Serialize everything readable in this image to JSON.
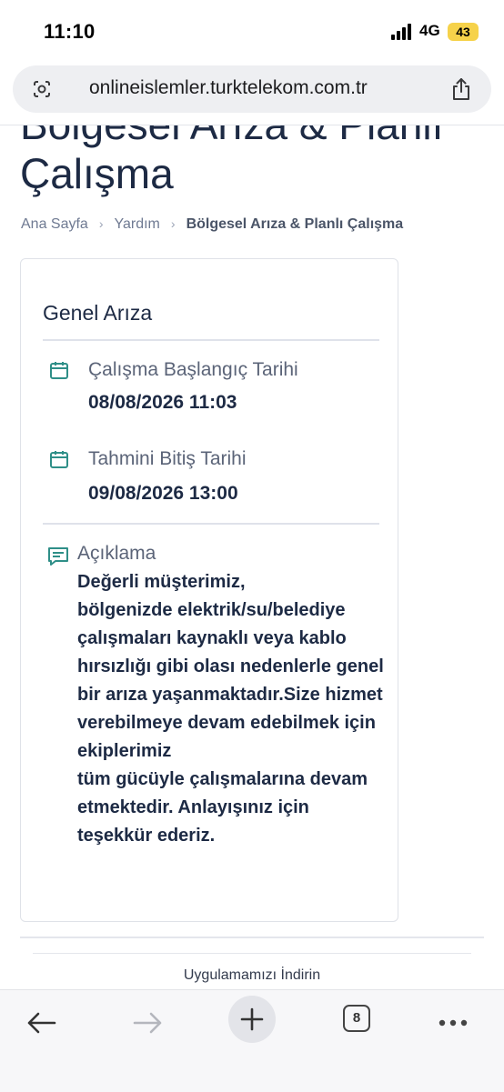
{
  "status": {
    "time": "11:10",
    "network": "4G",
    "battery": "43"
  },
  "browser": {
    "url": "onlineislemler.turktelekom.com.tr",
    "tab_count": "8"
  },
  "page": {
    "title": "Bölgesel Arıza & Planlı Çalışma",
    "breadcrumb": [
      "Ana Sayfa",
      "Yardım",
      "Bölgesel Arıza & Planlı Çalışma"
    ]
  },
  "card": {
    "title": "Genel Arıza",
    "start_label": "Çalışma Başlangıç Tarihi",
    "start_value": "08/08/2026 11:03",
    "end_label": "Tahmini Bitiş Tarihi",
    "end_value": "09/08/2026 13:00",
    "desc_label": "Açıklama",
    "desc_text": "Değerli müşterimiz,\nbölgenizde elektrik/su/belediye çalışmaları kaynaklı veya kablo hırsızlığı gibi olası nedenlerle genel bir arıza yaşanmaktadır.Size hizmet verebilmeye devam edebilmek için ekiplerimiz\ntüm gücüyle çalışmalarına devam etmektedir. Anlayışınız için teşekkür ederiz."
  },
  "footer": {
    "download_label": "Uygulamamızı İndirin"
  },
  "colors": {
    "accent_teal": "#2f8f88",
    "text_dark": "#1d2a44",
    "text_muted": "#5b6478"
  }
}
